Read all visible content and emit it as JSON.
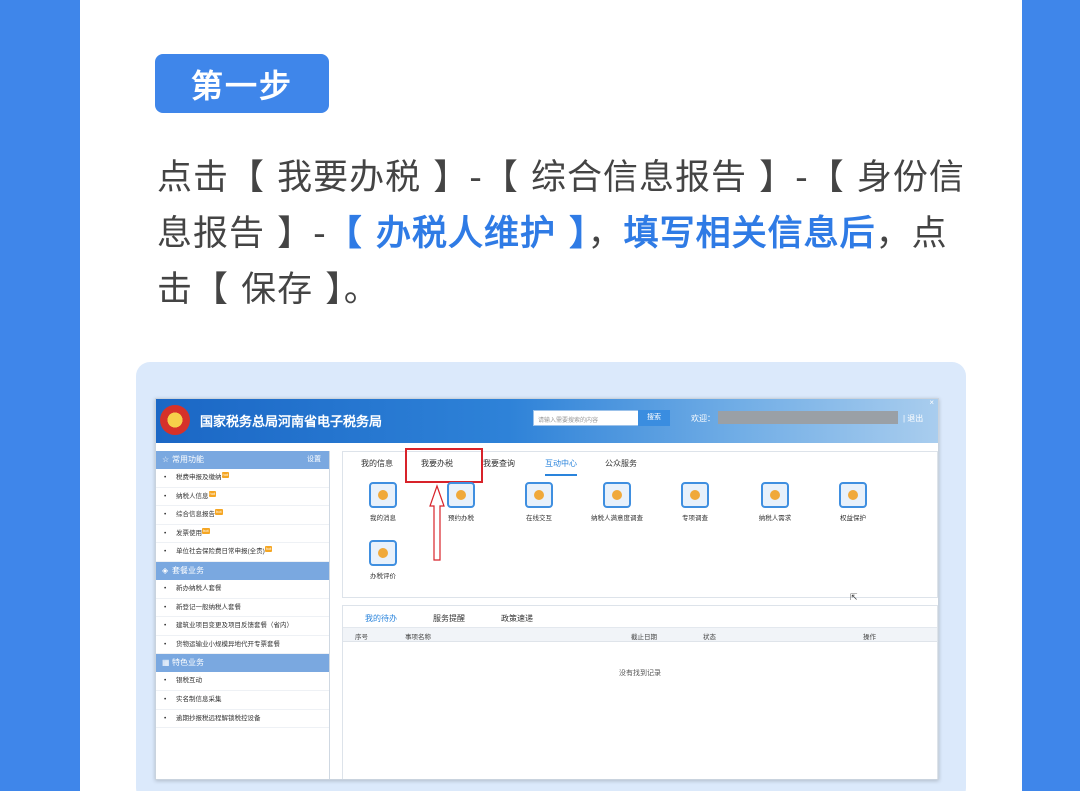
{
  "step_badge": "第一步",
  "instruction": {
    "part1": "点击【 我要办税 】-【 综合信息报告 】-【 身份信息报告 】-",
    "part2_highlight": "【 办税人维护 】",
    "part3": "，",
    "part4_highlight": "填写相关信息后",
    "part5": "，点击【 保存 】。"
  },
  "portal": {
    "title": "国家税务总局河南省电子税务局",
    "search_placeholder": "请输入需要搜索的内容",
    "search_button": "搜索",
    "welcome": "欢迎：",
    "logout": "| 退出",
    "close": "×"
  },
  "sidebar": {
    "sections": [
      {
        "label": "常用功能",
        "extra": "设置",
        "icon": "star-icon",
        "items": [
          {
            "label": "税费申报及缴纳",
            "hot": "hot"
          },
          {
            "label": "纳税人信息",
            "hot": "hot"
          },
          {
            "label": "综合信息报告",
            "hot": "hot"
          },
          {
            "label": "发票使用",
            "hot": "hot"
          },
          {
            "label": "单位社会保险费日常申报(全责)",
            "hot": "hot"
          }
        ]
      },
      {
        "label": "套餐业务",
        "extra": "",
        "icon": "layers-icon",
        "items": [
          {
            "label": "新办纳税人套餐",
            "hot": ""
          },
          {
            "label": "新登记一般纳税人套餐",
            "hot": ""
          },
          {
            "label": "建筑业项目变更及项目反馈套餐（省内）",
            "hot": ""
          },
          {
            "label": "货物运输业小规模异地代开专票套餐",
            "hot": ""
          }
        ]
      },
      {
        "label": "特色业务",
        "extra": "",
        "icon": "grid-icon",
        "items": [
          {
            "label": "银税互动",
            "hot": ""
          },
          {
            "label": "实名制信息采集",
            "hot": ""
          },
          {
            "label": "逾期抄报税远程解锁税控设备",
            "hot": ""
          }
        ]
      }
    ]
  },
  "main_tabs": [
    "我的信息",
    "我要办税",
    "我要查询",
    "互动中心",
    "公众服务"
  ],
  "services": [
    "我的消息",
    "预约办税",
    "在线交互",
    "纳税人满意度调查",
    "专项调查",
    "纳税人需求",
    "权益保护",
    "办税评价"
  ],
  "task_tabs": [
    "我的待办",
    "服务提醒",
    "政策速递"
  ],
  "table_headers": [
    "序号",
    "事项名称",
    "截止日期",
    "状态",
    "操作"
  ],
  "empty_text": "没有找到记录",
  "colors": {
    "page_bg": "#3f86ea",
    "highlight": "#2f7be5",
    "red_box": "#d8232a"
  }
}
